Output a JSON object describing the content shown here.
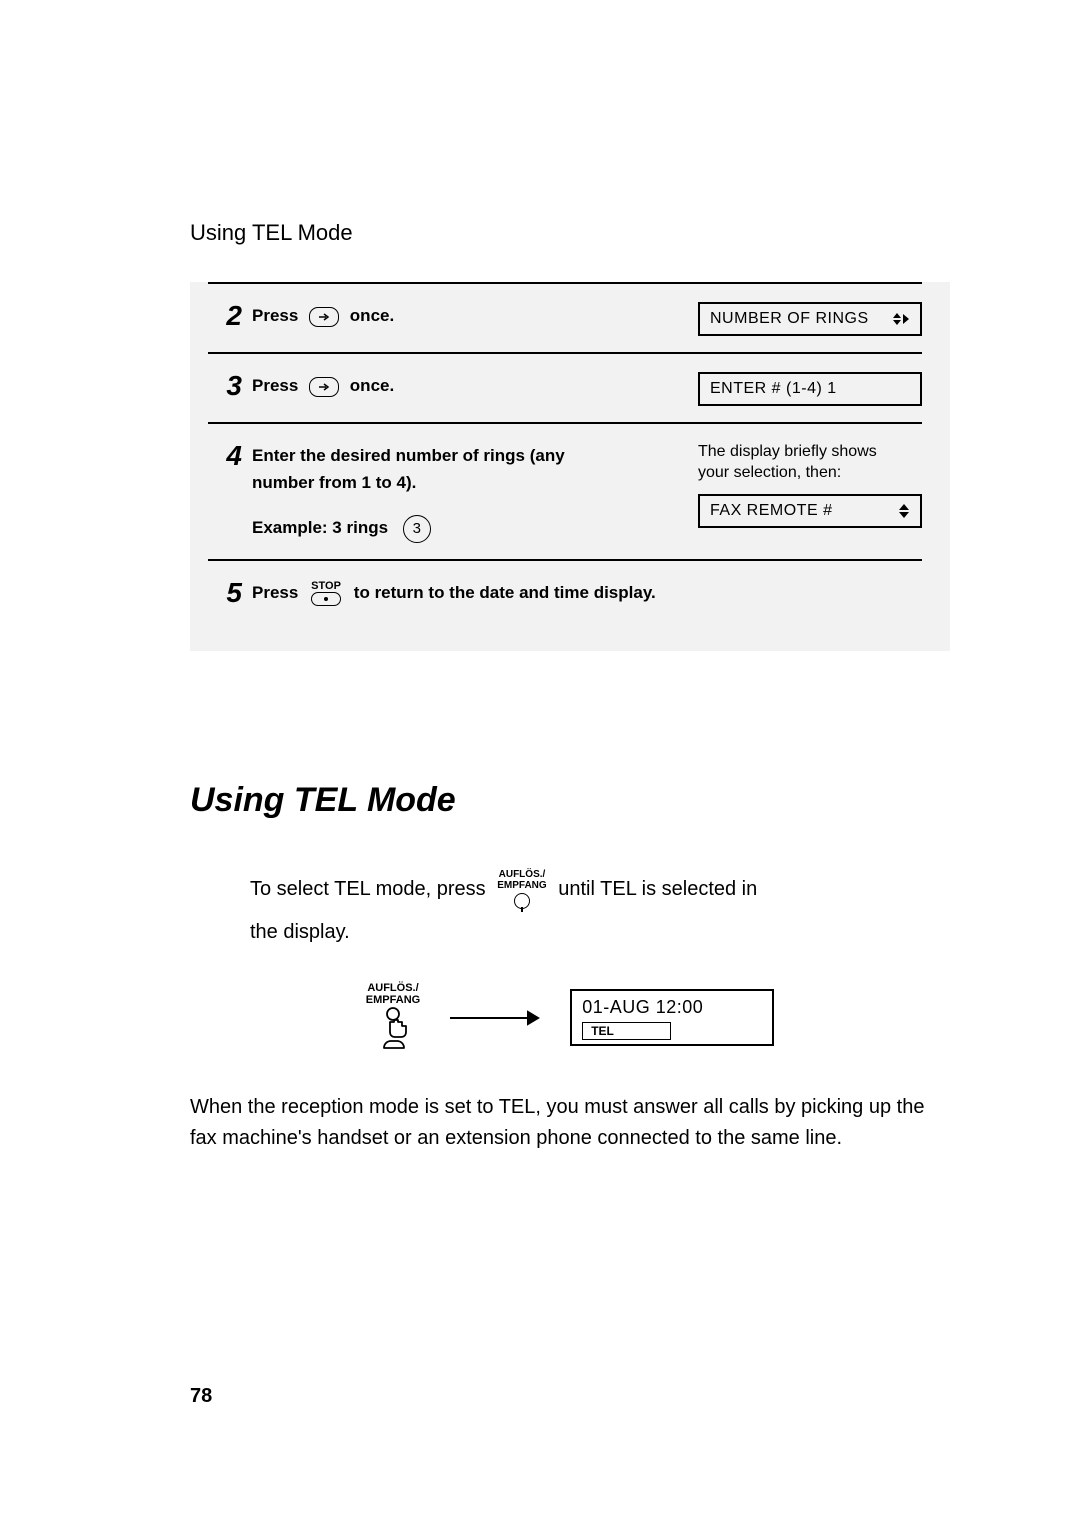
{
  "header": {
    "running_head": "Using TEL Mode"
  },
  "steps": [
    {
      "num": "2",
      "press": "Press",
      "once": "once.",
      "display": "NUMBER OF RINGS"
    },
    {
      "num": "3",
      "press": "Press",
      "once": "once.",
      "display": "ENTER # (1-4) 1"
    },
    {
      "num": "4",
      "instr_line1": "Enter the desired number of rings (any",
      "instr_line2": "number from 1 to 4).",
      "example": "Example: 3 rings",
      "example_digit": "3",
      "note_line1": "The display briefly shows",
      "note_line2": "your selection, then:",
      "display": "FAX REMOTE #"
    },
    {
      "num": "5",
      "press": "Press",
      "stop_label": "STOP",
      "tail": "to return to the date and time display."
    }
  ],
  "section": {
    "title": "Using TEL Mode",
    "intro_a": "To select TEL mode, press",
    "btn_l1": "AUFLÖS./",
    "btn_l2": "EMPFANG",
    "intro_b": "until TEL is selected in",
    "intro_c": "the display.",
    "display_date": "01-AUG  12:00",
    "display_mode": "TEL",
    "paragraph": "When the reception mode is set to TEL, you must answer all calls by picking up the fax machine's handset or an extension phone connected to the same line."
  },
  "page_number": "78"
}
